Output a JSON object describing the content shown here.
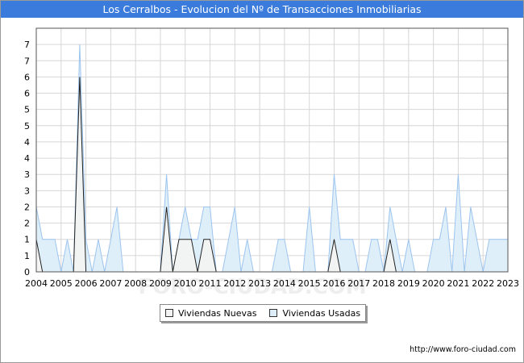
{
  "title": "Los Cerralbos - Evolucion del Nº de Transacciones Inmobiliarias",
  "source": "http://www.foro-ciudad.com",
  "watermark": "FORO-CIUDAD.COM",
  "colors": {
    "title_bg": "#3a7bdc",
    "usadas_fill": "#ddeefa",
    "usadas_line": "#9cc4ee",
    "nuevas_fill": "#f2f2f2",
    "nuevas_line": "#222222",
    "grid": "#d6d6d6"
  },
  "chart_data": {
    "type": "area",
    "title": "Los Cerralbos - Evolucion del Nº de Transacciones Inmobiliarias",
    "xlabel": "",
    "ylabel": "",
    "x_ticks": [
      "2004",
      "2005",
      "2006",
      "2007",
      "2008",
      "2009",
      "2010",
      "2011",
      "2012",
      "2013",
      "2014",
      "2015",
      "2016",
      "2017",
      "2018",
      "2019",
      "2020",
      "2021",
      "2022",
      "2023"
    ],
    "y_ticks": [
      "0",
      "1",
      "1",
      "2",
      "2",
      "3",
      "3",
      "4",
      "4",
      "5",
      "5",
      "6",
      "6",
      "7",
      "7"
    ],
    "y_tick_values": [
      0,
      0.5,
      1,
      1.5,
      2,
      2.5,
      3,
      3.5,
      4,
      4.5,
      5,
      5.5,
      6,
      6.5,
      7
    ],
    "xlim": [
      2004,
      2023
    ],
    "ylim": [
      0,
      7.5
    ],
    "grid": true,
    "legend_position": "bottom",
    "series": [
      {
        "name": "Viviendas Usadas",
        "points": [
          [
            2004.0,
            2
          ],
          [
            2004.25,
            1
          ],
          [
            2004.5,
            1
          ],
          [
            2004.75,
            1
          ],
          [
            2005.0,
            0
          ],
          [
            2005.25,
            1
          ],
          [
            2005.5,
            0
          ],
          [
            2005.75,
            7
          ],
          [
            2006.0,
            1
          ],
          [
            2006.25,
            0
          ],
          [
            2006.5,
            1
          ],
          [
            2006.75,
            0
          ],
          [
            2007.0,
            1
          ],
          [
            2007.25,
            2
          ],
          [
            2007.5,
            0
          ],
          [
            2007.75,
            0
          ],
          [
            2008.0,
            0
          ],
          [
            2008.25,
            0
          ],
          [
            2008.5,
            0
          ],
          [
            2008.75,
            0
          ],
          [
            2009.0,
            0
          ],
          [
            2009.25,
            3
          ],
          [
            2009.5,
            0
          ],
          [
            2009.75,
            1
          ],
          [
            2010.0,
            2
          ],
          [
            2010.25,
            1
          ],
          [
            2010.5,
            1
          ],
          [
            2010.75,
            2
          ],
          [
            2011.0,
            2
          ],
          [
            2011.25,
            0
          ],
          [
            2011.5,
            0
          ],
          [
            2011.75,
            1
          ],
          [
            2012.0,
            2
          ],
          [
            2012.25,
            0
          ],
          [
            2012.5,
            1
          ],
          [
            2012.75,
            0
          ],
          [
            2013.0,
            0
          ],
          [
            2013.25,
            0
          ],
          [
            2013.5,
            0
          ],
          [
            2013.75,
            1
          ],
          [
            2014.0,
            1
          ],
          [
            2014.25,
            0
          ],
          [
            2014.5,
            0
          ],
          [
            2014.75,
            0
          ],
          [
            2015.0,
            2
          ],
          [
            2015.25,
            0
          ],
          [
            2015.5,
            0
          ],
          [
            2015.75,
            0
          ],
          [
            2016.0,
            3
          ],
          [
            2016.25,
            1
          ],
          [
            2016.5,
            1
          ],
          [
            2016.75,
            1
          ],
          [
            2017.0,
            0
          ],
          [
            2017.25,
            0
          ],
          [
            2017.5,
            1
          ],
          [
            2017.75,
            1
          ],
          [
            2018.0,
            0
          ],
          [
            2018.25,
            2
          ],
          [
            2018.5,
            1
          ],
          [
            2018.75,
            0
          ],
          [
            2019.0,
            1
          ],
          [
            2019.25,
            0
          ],
          [
            2019.5,
            0
          ],
          [
            2019.75,
            0
          ],
          [
            2020.0,
            1
          ],
          [
            2020.25,
            1
          ],
          [
            2020.5,
            2
          ],
          [
            2020.75,
            0
          ],
          [
            2021.0,
            3
          ],
          [
            2021.25,
            0
          ],
          [
            2021.5,
            2
          ],
          [
            2021.75,
            1
          ],
          [
            2022.0,
            0
          ],
          [
            2022.25,
            1
          ],
          [
            2022.5,
            1
          ],
          [
            2022.75,
            1
          ],
          [
            2023.0,
            1
          ]
        ]
      },
      {
        "name": "Viviendas Nuevas",
        "points": [
          [
            2004.0,
            1
          ],
          [
            2004.25,
            0
          ],
          [
            2004.5,
            0
          ],
          [
            2004.75,
            0
          ],
          [
            2005.0,
            0
          ],
          [
            2005.25,
            0
          ],
          [
            2005.5,
            0
          ],
          [
            2005.75,
            6
          ],
          [
            2006.0,
            0
          ],
          [
            2006.25,
            0
          ],
          [
            2006.5,
            0
          ],
          [
            2006.75,
            0
          ],
          [
            2007.0,
            0
          ],
          [
            2007.25,
            0
          ],
          [
            2007.5,
            0
          ],
          [
            2007.75,
            0
          ],
          [
            2008.0,
            0
          ],
          [
            2008.25,
            0
          ],
          [
            2008.5,
            0
          ],
          [
            2008.75,
            0
          ],
          [
            2009.0,
            0
          ],
          [
            2009.25,
            2
          ],
          [
            2009.5,
            0
          ],
          [
            2009.75,
            1
          ],
          [
            2010.0,
            1
          ],
          [
            2010.25,
            1
          ],
          [
            2010.5,
            0
          ],
          [
            2010.75,
            1
          ],
          [
            2011.0,
            1
          ],
          [
            2011.25,
            0
          ],
          [
            2011.5,
            0
          ],
          [
            2011.75,
            0
          ],
          [
            2012.0,
            0
          ],
          [
            2012.25,
            0
          ],
          [
            2012.5,
            0
          ],
          [
            2012.75,
            0
          ],
          [
            2013.0,
            0
          ],
          [
            2013.25,
            0
          ],
          [
            2013.5,
            0
          ],
          [
            2013.75,
            0
          ],
          [
            2014.0,
            0
          ],
          [
            2014.25,
            0
          ],
          [
            2014.5,
            0
          ],
          [
            2014.75,
            0
          ],
          [
            2015.0,
            0
          ],
          [
            2015.25,
            0
          ],
          [
            2015.5,
            0
          ],
          [
            2015.75,
            0
          ],
          [
            2016.0,
            1
          ],
          [
            2016.25,
            0
          ],
          [
            2016.5,
            0
          ],
          [
            2016.75,
            0
          ],
          [
            2017.0,
            0
          ],
          [
            2017.25,
            0
          ],
          [
            2017.5,
            0
          ],
          [
            2017.75,
            0
          ],
          [
            2018.0,
            0
          ],
          [
            2018.25,
            1
          ],
          [
            2018.5,
            0
          ],
          [
            2018.75,
            0
          ],
          [
            2019.0,
            0
          ],
          [
            2019.25,
            0
          ],
          [
            2019.5,
            0
          ],
          [
            2019.75,
            0
          ],
          [
            2020.0,
            0
          ],
          [
            2020.25,
            0
          ],
          [
            2020.5,
            0
          ],
          [
            2020.75,
            0
          ],
          [
            2021.0,
            0
          ],
          [
            2021.25,
            0
          ],
          [
            2021.5,
            0
          ],
          [
            2021.75,
            0
          ],
          [
            2022.0,
            0
          ],
          [
            2022.25,
            0
          ],
          [
            2022.5,
            0
          ],
          [
            2022.75,
            0
          ],
          [
            2023.0,
            0
          ]
        ]
      }
    ]
  },
  "legend": {
    "nuevas_label": "Viviendas Nuevas",
    "usadas_label": "Viviendas Usadas"
  }
}
